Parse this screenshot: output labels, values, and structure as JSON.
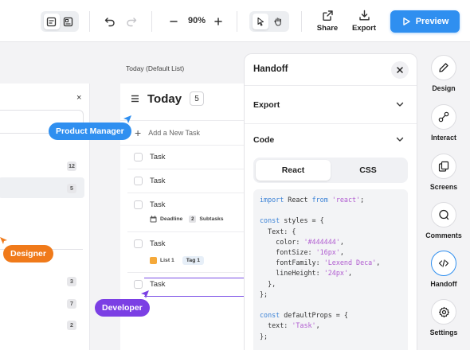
{
  "toolbar": {
    "zoom": "90%",
    "share_label": "Share",
    "export_label": "Export",
    "preview_label": "Preview",
    "accent": "#2f8ff0"
  },
  "left_panel": {
    "close_glyph": "×",
    "badges": [
      "12",
      "5",
      "3",
      "7",
      "2"
    ]
  },
  "task_list": {
    "caption": "Today (Default List)",
    "title": "Today",
    "count": "5",
    "add_placeholder": "Add a New Task",
    "tasks": [
      {
        "name": "Task"
      },
      {
        "name": "Task"
      },
      {
        "name": "Task",
        "meta": [
          "Deadline",
          "2",
          "Subtasks"
        ]
      },
      {
        "name": "Task",
        "meta": [
          "List 1",
          "Tag 1"
        ]
      },
      {
        "name": "Task"
      }
    ]
  },
  "collaborators": [
    {
      "name": "Product Manager",
      "color": "#2f8ff0"
    },
    {
      "name": "Designer",
      "color": "#f07a1a"
    },
    {
      "name": "Developer",
      "color": "#7b3fe4"
    }
  ],
  "handoff": {
    "title": "Handoff",
    "close_glyph": "×",
    "sections": [
      "Export",
      "Code"
    ],
    "tabs": [
      "React",
      "CSS"
    ],
    "active_tab": "React"
  },
  "right_sidebar": {
    "items": [
      {
        "label": "Design",
        "icon": "pen-icon"
      },
      {
        "label": "Interact",
        "icon": "interact-icon"
      },
      {
        "label": "Screens",
        "icon": "screens-icon"
      },
      {
        "label": "Comments",
        "icon": "comment-icon"
      },
      {
        "label": "Handoff",
        "icon": "code-icon",
        "active": true
      },
      {
        "label": "Settings",
        "icon": "settings-icon"
      }
    ]
  }
}
